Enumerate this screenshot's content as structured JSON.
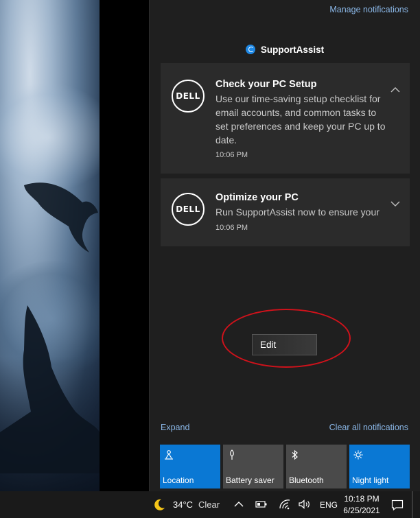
{
  "action_center": {
    "manage_label": "Manage notifications",
    "group_app_name": "SupportAssist",
    "notifications": [
      {
        "logo_text": "DELL",
        "title": "Check your PC Setup",
        "body": "Use our time-saving setup checklist for email accounts, and common tasks to set preferences and keep your PC up to date.",
        "time": "10:06 PM",
        "chevron": "chevron-up-icon"
      },
      {
        "logo_text": "DELL",
        "title": "Optimize your PC",
        "body": "Run SupportAssist now to ensure your",
        "time": "10:06 PM",
        "chevron": "chevron-down-icon"
      }
    ],
    "context_menu": {
      "item": "Edit"
    },
    "expand_label": "Expand",
    "clear_label": "Clear all notifications",
    "quick_actions": [
      {
        "label": "Location",
        "icon": "location-icon",
        "active": true
      },
      {
        "label": "Battery saver",
        "icon": "battery-saver-icon",
        "active": false
      },
      {
        "label": "Bluetooth",
        "icon": "bluetooth-icon",
        "active": false
      },
      {
        "label": "Night light",
        "icon": "night-light-icon",
        "active": true
      }
    ]
  },
  "taskbar": {
    "weather_icon": "moon-icon",
    "weather_temp": "34°C",
    "weather_condition": "Clear",
    "language": "ENG",
    "time": "10:18 PM",
    "date": "6/25/2021"
  },
  "colors": {
    "accent": "#0a78d4",
    "link": "#8bb8e8",
    "panel": "#1f1f1f",
    "toast": "#2b2b2b",
    "annotation": "#d0121b"
  }
}
